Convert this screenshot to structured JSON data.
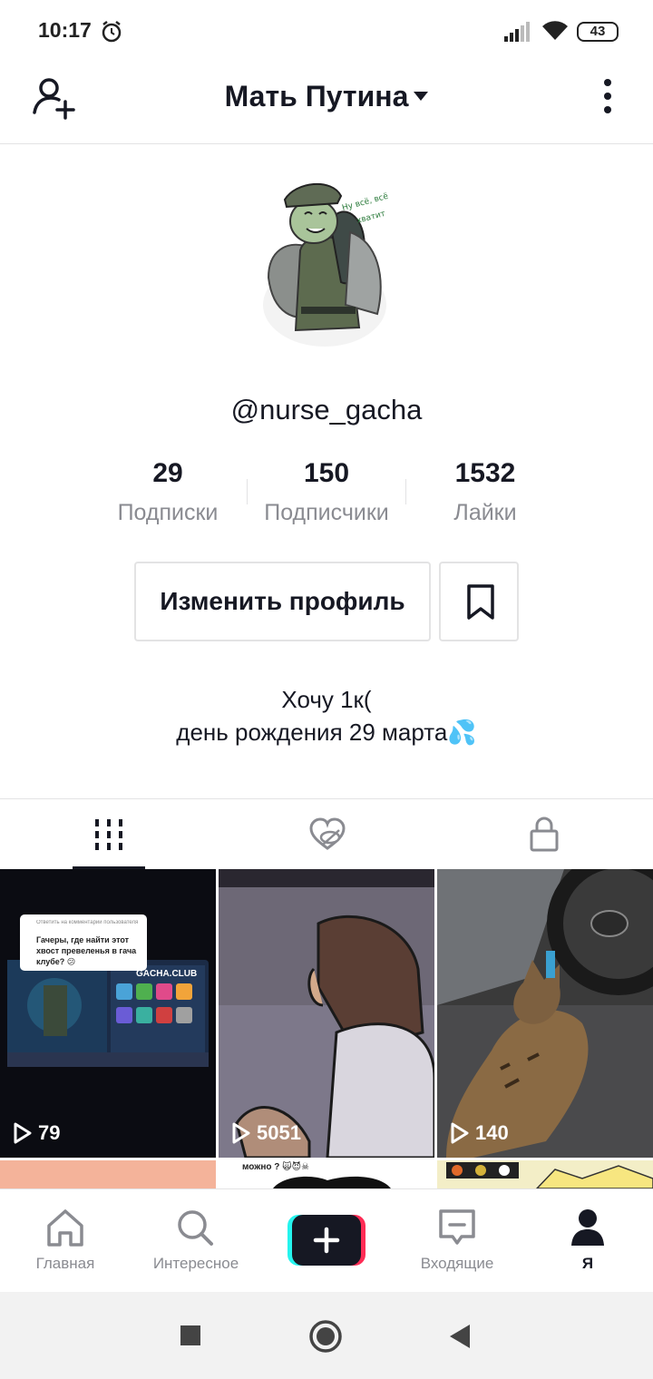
{
  "status_bar": {
    "time": "10:17",
    "battery": "43"
  },
  "header": {
    "title": "Мать Путина",
    "icons": [
      "add-user-icon",
      "chevron-down-icon",
      "more-vertical-icon"
    ]
  },
  "profile": {
    "username": "@nurse_gacha",
    "stats": [
      {
        "value": "29",
        "label": "Подписки"
      },
      {
        "value": "150",
        "label": "Подписчики"
      },
      {
        "value": "1532",
        "label": "Лайки"
      }
    ],
    "edit_button": "Изменить профиль",
    "bio_line1": "Хочу 1к(",
    "bio_line2": "день рождения 29 марта💦"
  },
  "tabs": [
    {
      "icon": "grid-icon",
      "active": true
    },
    {
      "icon": "liked-hidden-icon",
      "active": false
    },
    {
      "icon": "lock-icon",
      "active": false
    }
  ],
  "videos": [
    {
      "views": "79"
    },
    {
      "views": "5051"
    },
    {
      "views": "140"
    }
  ],
  "video1_overlay": {
    "comment_reply": "Ответить на комментарий пользователя",
    "comment_text": "Гачеры, где найти этот хвост превеленья в гача клубе? 😕",
    "app_name": "GACHA.CLUB"
  },
  "video_row2_caption": "можно ? 🙀😈☠",
  "bottom_nav": [
    {
      "label": "Главная",
      "icon": "home-icon"
    },
    {
      "label": "Интересное",
      "icon": "search-icon"
    },
    {
      "label": "",
      "icon": "create-plus-icon"
    },
    {
      "label": "Входящие",
      "icon": "inbox-icon"
    },
    {
      "label": "Я",
      "icon": "profile-icon",
      "active": true
    }
  ],
  "colors": {
    "text": "#161823",
    "muted": "#8a8b91",
    "border": "#e3e3e4",
    "cyan": "#25f4ee",
    "red": "#fe2c55"
  }
}
